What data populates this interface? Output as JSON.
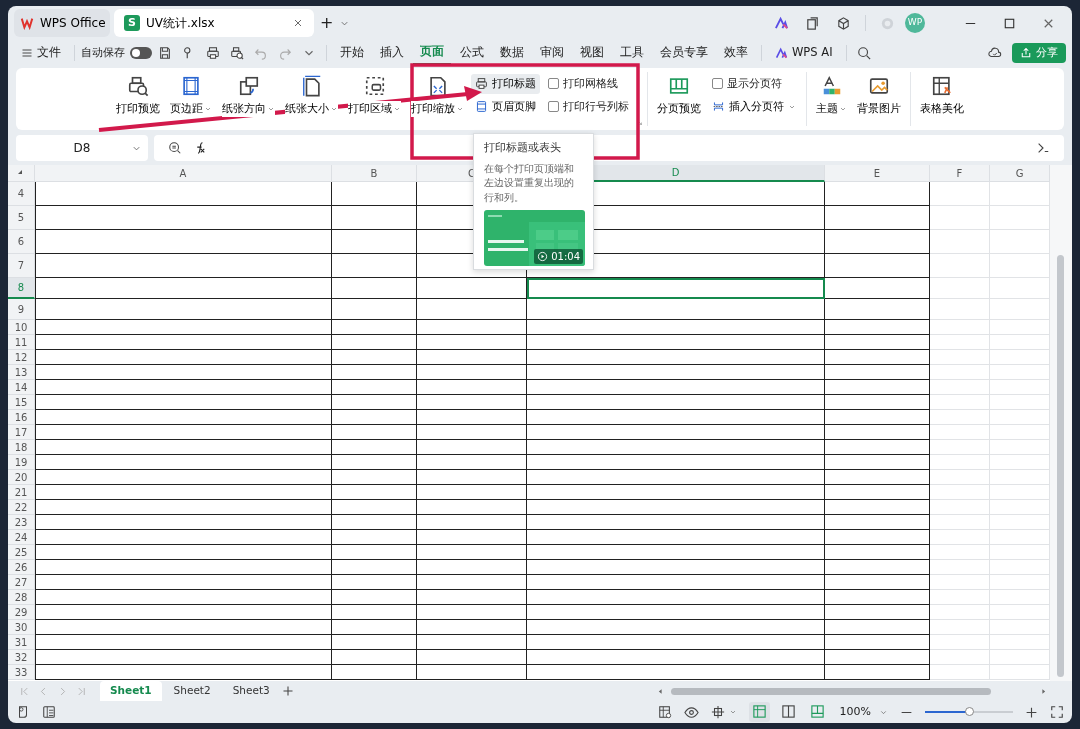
{
  "window_tabs": [
    {
      "label": "WPS Office",
      "kind": "home",
      "selected": false
    },
    {
      "label": "UV统计.xlsx",
      "kind": "sheet",
      "file_letter": "S",
      "selected": true
    }
  ],
  "new_tab": "+",
  "avatar": "WP",
  "quick_bar": {
    "file": "文件",
    "autosave": "自动保存",
    "autosave_on": false
  },
  "menu_tabs": [
    {
      "label": "开始",
      "selected": false
    },
    {
      "label": "插入",
      "selected": false
    },
    {
      "label": "页面",
      "selected": true
    },
    {
      "label": "公式",
      "selected": false
    },
    {
      "label": "数据",
      "selected": false
    },
    {
      "label": "审阅",
      "selected": false
    },
    {
      "label": "视图",
      "selected": false
    },
    {
      "label": "工具",
      "selected": false
    },
    {
      "label": "会员专享",
      "selected": false
    },
    {
      "label": "效率",
      "selected": false
    }
  ],
  "ai_label": "WPS AI",
  "share_label": "分享",
  "ribbon": {
    "groups": [
      {
        "launcher": true,
        "items": [
          {
            "kind": "large",
            "label": "打印预览",
            "dropdown": false
          },
          {
            "kind": "large",
            "label": "页边距",
            "dropdown": true
          },
          {
            "kind": "large",
            "label": "纸张方向",
            "dropdown": true
          },
          {
            "kind": "large",
            "label": "纸张大小",
            "dropdown": true
          },
          {
            "kind": "large",
            "label": "打印区域",
            "dropdown": true
          },
          {
            "kind": "large",
            "label": "打印缩放",
            "dropdown": true
          },
          {
            "kind": "stack",
            "items": [
              {
                "kind": "button",
                "label": "打印标题",
                "highlighted": true,
                "dropdown": false
              },
              {
                "kind": "button",
                "label": "页眉页脚",
                "highlighted": false,
                "dropdown": false
              }
            ]
          },
          {
            "kind": "stack",
            "items": [
              {
                "kind": "check",
                "label": "打印网格线",
                "checked": false
              },
              {
                "kind": "check",
                "label": "打印行号列标",
                "checked": false
              }
            ]
          }
        ]
      },
      {
        "launcher": false,
        "items": [
          {
            "kind": "large",
            "label": "分页预览",
            "dropdown": false
          },
          {
            "kind": "stack",
            "items": [
              {
                "kind": "check",
                "label": "显示分页符",
                "checked": false
              },
              {
                "kind": "button",
                "label": "插入分页符",
                "highlighted": false,
                "dropdown": true
              }
            ]
          }
        ]
      },
      {
        "launcher": false,
        "items": [
          {
            "kind": "large",
            "label": "主题",
            "dropdown": true
          },
          {
            "kind": "large",
            "label": "背景图片",
            "dropdown": false
          }
        ]
      },
      {
        "launcher": false,
        "items": [
          {
            "kind": "large",
            "label": "表格美化",
            "dropdown": false
          }
        ]
      }
    ]
  },
  "formula_bar": {
    "name_box": "D8"
  },
  "sheet": {
    "columns": [
      {
        "label": "A",
        "selected": false
      },
      {
        "label": "B",
        "selected": false
      },
      {
        "label": "C",
        "selected": false
      },
      {
        "label": "D",
        "selected": true
      },
      {
        "label": "E",
        "selected": false
      },
      {
        "label": "F",
        "selected": false
      },
      {
        "label": "G",
        "selected": false
      }
    ],
    "rows": [
      {
        "label": "4",
        "selected": false
      },
      {
        "label": "5",
        "selected": false
      },
      {
        "label": "6",
        "selected": false
      },
      {
        "label": "7",
        "selected": false
      },
      {
        "label": "8",
        "selected": true
      },
      {
        "label": "9",
        "selected": false
      },
      {
        "label": "10",
        "selected": false
      },
      {
        "label": "11",
        "selected": false
      },
      {
        "label": "12",
        "selected": false
      },
      {
        "label": "13",
        "selected": false
      },
      {
        "label": "14",
        "selected": false
      },
      {
        "label": "15",
        "selected": false
      },
      {
        "label": "16",
        "selected": false
      },
      {
        "label": "17",
        "selected": false
      },
      {
        "label": "18",
        "selected": false
      },
      {
        "label": "19",
        "selected": false
      },
      {
        "label": "20",
        "selected": false
      },
      {
        "label": "21",
        "selected": false
      },
      {
        "label": "22",
        "selected": false
      },
      {
        "label": "23",
        "selected": false
      },
      {
        "label": "24",
        "selected": false
      },
      {
        "label": "25",
        "selected": false
      },
      {
        "label": "26",
        "selected": false
      },
      {
        "label": "27",
        "selected": false
      },
      {
        "label": "28",
        "selected": false
      },
      {
        "label": "29",
        "selected": false
      },
      {
        "label": "30",
        "selected": false
      },
      {
        "label": "31",
        "selected": false
      },
      {
        "label": "32",
        "selected": false
      },
      {
        "label": "33",
        "selected": false
      }
    ]
  },
  "tooltip": {
    "title": "打印标题或表头",
    "text": "在每个打印页顶端和左边设置重复出现的行和列。",
    "duration": "01:04"
  },
  "sheet_tabs": [
    {
      "label": "Sheet1",
      "selected": true
    },
    {
      "label": "Sheet2",
      "selected": false
    },
    {
      "label": "Sheet3",
      "selected": false
    }
  ],
  "status_bar": {
    "view_modes": [
      {
        "kind": "normal",
        "selected": true
      },
      {
        "kind": "split",
        "selected": false
      },
      {
        "kind": "page",
        "selected": false
      }
    ],
    "zoom": "100%",
    "zoom_slider": {
      "level": 0.5
    }
  }
}
